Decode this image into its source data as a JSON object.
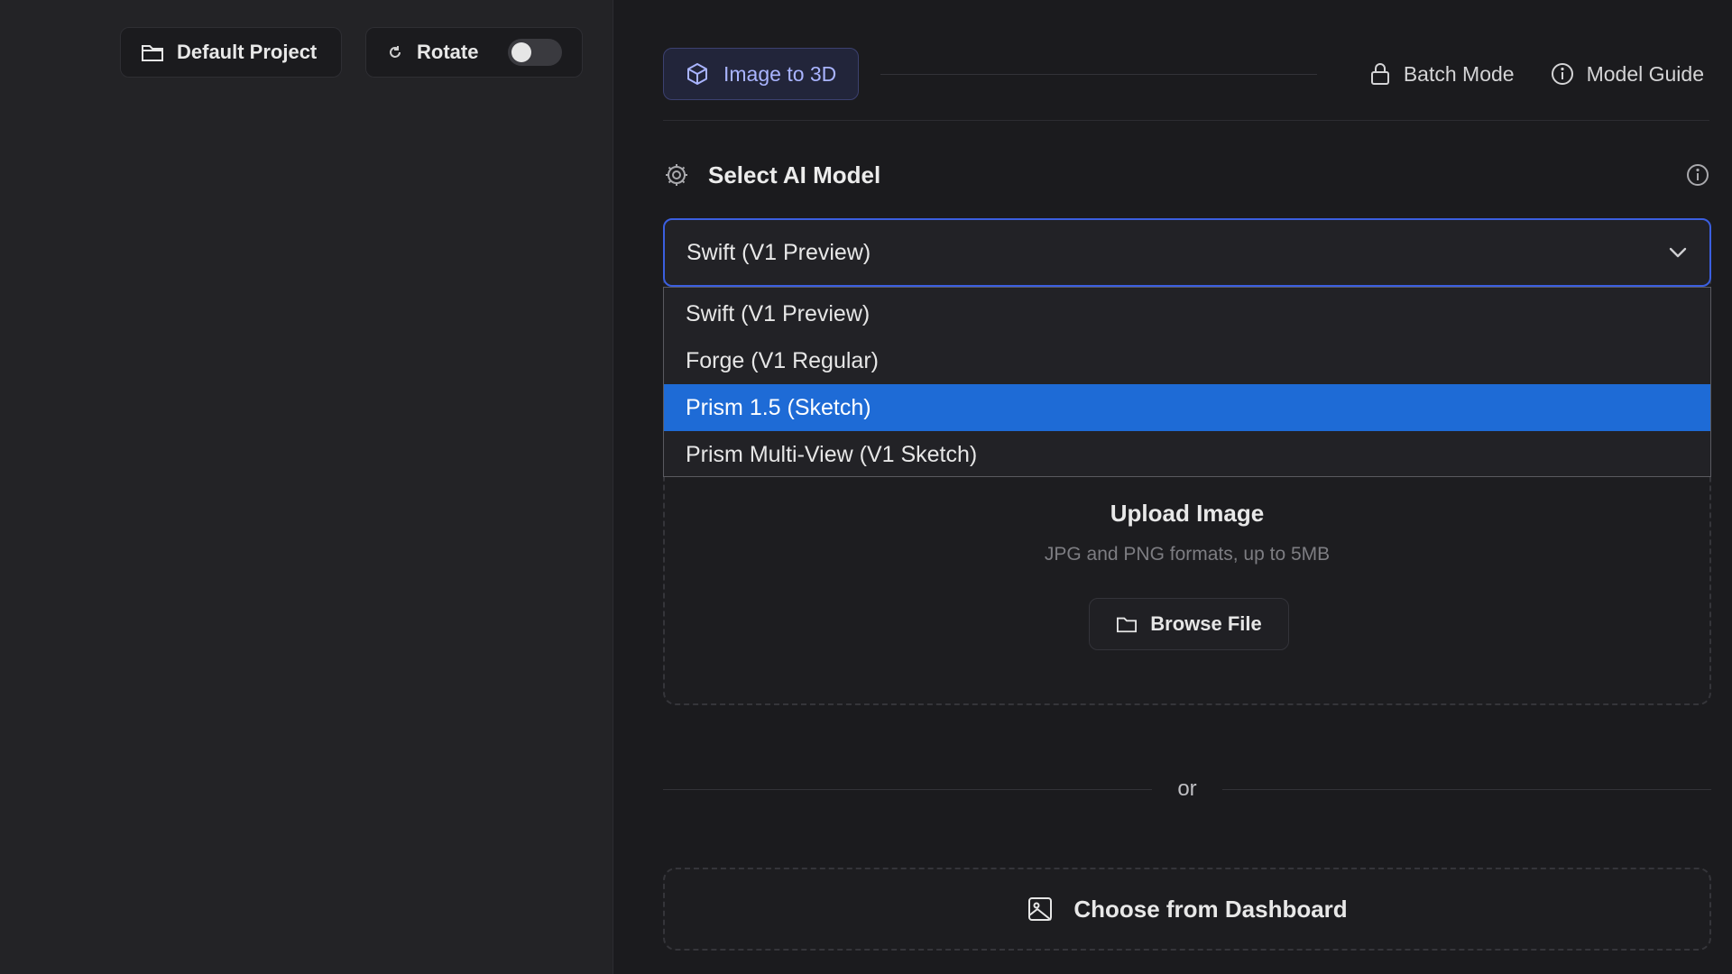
{
  "viewport": {
    "project_label": "Default Project",
    "rotate_label": "Rotate",
    "rotate_enabled": false
  },
  "tabs": {
    "active": {
      "label": "Image to 3D",
      "icon": "cube-icon"
    },
    "links": [
      {
        "label": "Batch Mode",
        "icon": "lock-icon"
      },
      {
        "label": "Model Guide",
        "icon": "info-icon"
      }
    ]
  },
  "model_section": {
    "title": "Select AI Model",
    "selected_value": "Swift (V1 Preview)",
    "options": [
      "Swift (V1 Preview)",
      "Forge (V1 Regular)",
      "Prism 1.5 (Sketch)",
      "Prism Multi-View (V1 Sketch)"
    ],
    "highlighted_option": "Prism 1.5 (Sketch)"
  },
  "upload": {
    "title": "Upload Image",
    "subtitle": "JPG and PNG formats, up to 5MB",
    "browse_label": "Browse File"
  },
  "separator_text": "or",
  "dashboard_button_label": "Choose from Dashboard",
  "colors": {
    "accent": "#1e6bd6",
    "focus_border": "#3b5fe0",
    "tab_active_text": "#a9b4ff"
  }
}
